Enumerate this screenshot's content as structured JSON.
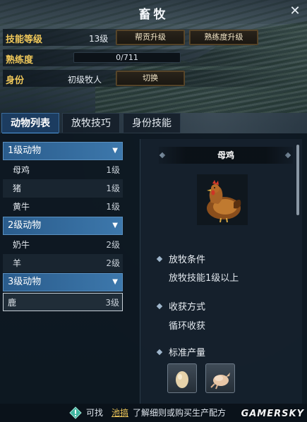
{
  "window": {
    "title": "畜牧",
    "close_symbol": "✕"
  },
  "info": {
    "skill_level_label": "技能等级",
    "skill_level_value": "13级",
    "help_upgrade_button": "帮贡升级",
    "proficiency_upgrade_button": "熟练度升级",
    "proficiency_label": "熟练度",
    "proficiency_text": "0/711",
    "proficiency_fraction": 0,
    "identity_label": "身份",
    "identity_value": "初级牧人",
    "switch_button": "切换"
  },
  "tabs": [
    {
      "label": "动物列表",
      "active": true
    },
    {
      "label": "放牧技巧",
      "active": false
    },
    {
      "label": "身份技能",
      "active": false
    }
  ],
  "animal_groups": [
    {
      "label": "1级动物",
      "items": [
        {
          "name": "母鸡",
          "level": "1级"
        },
        {
          "name": "猪",
          "level": "1级"
        },
        {
          "name": "黄牛",
          "level": "1级"
        }
      ]
    },
    {
      "label": "2级动物",
      "items": [
        {
          "name": "奶牛",
          "level": "2级"
        },
        {
          "name": "羊",
          "level": "2级"
        }
      ]
    },
    {
      "label": "3级动物",
      "items": [
        {
          "name": "鹿",
          "level": "3级"
        }
      ]
    }
  ],
  "detail": {
    "name": "母鸡",
    "condition_title": "放牧条件",
    "condition_text": "放牧技能1级以上",
    "harvest_title": "收获方式",
    "harvest_text": "循环收获",
    "yield_title": "标准产量",
    "yield_items": [
      "egg-icon",
      "chicken-meat-icon"
    ]
  },
  "footer": {
    "pre": "可找",
    "link": "池搞",
    "post": "了解细则或购买生产配方",
    "watermark": "GAMERSKY"
  },
  "colors": {
    "accent_gold": "#f0c85a",
    "tab_active": "#1c3c60",
    "group_header": "#3d78ac",
    "progress_fill": "#4a9bd4"
  }
}
